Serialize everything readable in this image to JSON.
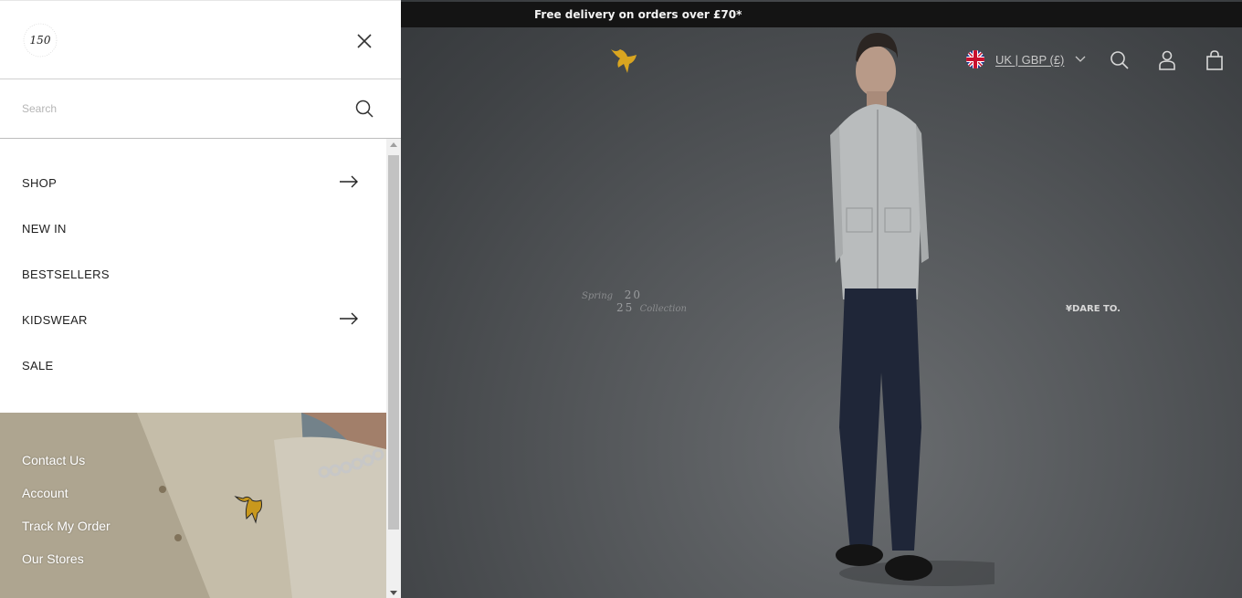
{
  "promo": {
    "text": "Free delivery on orders over £70*"
  },
  "header": {
    "locale_label": "UK | GBP (£)",
    "icons": [
      "flag-uk-icon",
      "chevron-down-icon",
      "search-icon",
      "account-icon",
      "bag-icon"
    ]
  },
  "hero": {
    "season": "Spring",
    "year_top": "20",
    "year_bottom": "25",
    "collection": "Collection",
    "tagline": "DARE TO"
  },
  "drawer": {
    "badge_text": "150",
    "search_placeholder": "Search",
    "nav": [
      {
        "label": "SHOP",
        "has_arrow": true
      },
      {
        "label": "NEW IN",
        "has_arrow": false
      },
      {
        "label": "BESTSELLERS",
        "has_arrow": false
      },
      {
        "label": "KIDSWEAR",
        "has_arrow": true
      },
      {
        "label": "SALE",
        "has_arrow": false
      }
    ],
    "footer_links": [
      "Contact Us",
      "Account",
      "Track My Order",
      "Our Stores"
    ]
  },
  "colors": {
    "promo_bar": "#141414",
    "brand_eagle": "#d9a520",
    "drawer_bg": "#ffffff",
    "text_dark": "#1f1f1f"
  }
}
